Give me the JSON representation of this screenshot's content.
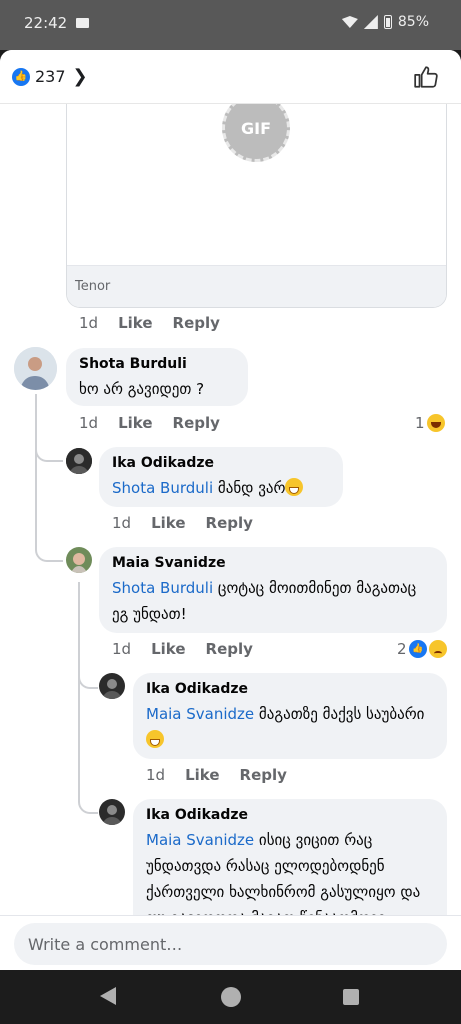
{
  "status_bar": {
    "time": "22:42",
    "battery": "85%"
  },
  "header": {
    "reaction_count": "237"
  },
  "gif_card": {
    "label": "GIF",
    "source": "Tenor"
  },
  "comments": [
    {
      "time": "1d",
      "like": "Like",
      "reply": "Reply"
    },
    {
      "author": "Shota Burduli",
      "text": "ხო არ გავიდეთ ?",
      "time": "1d",
      "like": "Like",
      "reply": "Reply",
      "reaction_count": "1"
    },
    {
      "author": "Ika Odikadze",
      "mention": "Shota Burduli",
      "text": " მანდ ვარ",
      "time": "1d",
      "like": "Like",
      "reply": "Reply"
    },
    {
      "author": "Maia Svanidze",
      "mention": "Shota Burduli",
      "text": " ცოტაც მოითმინეთ მაგათაც ეგ უნდათ!",
      "time": "1d",
      "like": "Like",
      "reply": "Reply",
      "reaction_count": "2"
    },
    {
      "author": "Ika Odikadze",
      "mention": "Maia Svanidze",
      "text": " მაგათზე მაქვს საუბარი",
      "time": "1d",
      "like": "Like",
      "reply": "Reply"
    },
    {
      "author": "Ika Odikadze",
      "mention": "Maia Svanidze",
      "text": " ისიც ვიცით რაც უნდათვდა რასაც ელოდებოდნენ ქართველი ხალხინრომ გასულიყო და თუ გავიდოდა მაგათ წინააღმდეგ"
    }
  ],
  "composer": {
    "placeholder": "Write a comment…"
  },
  "colors": {
    "accent": "#1877f2",
    "mention": "#1b6ac9",
    "bubble": "#f0f2f5"
  }
}
